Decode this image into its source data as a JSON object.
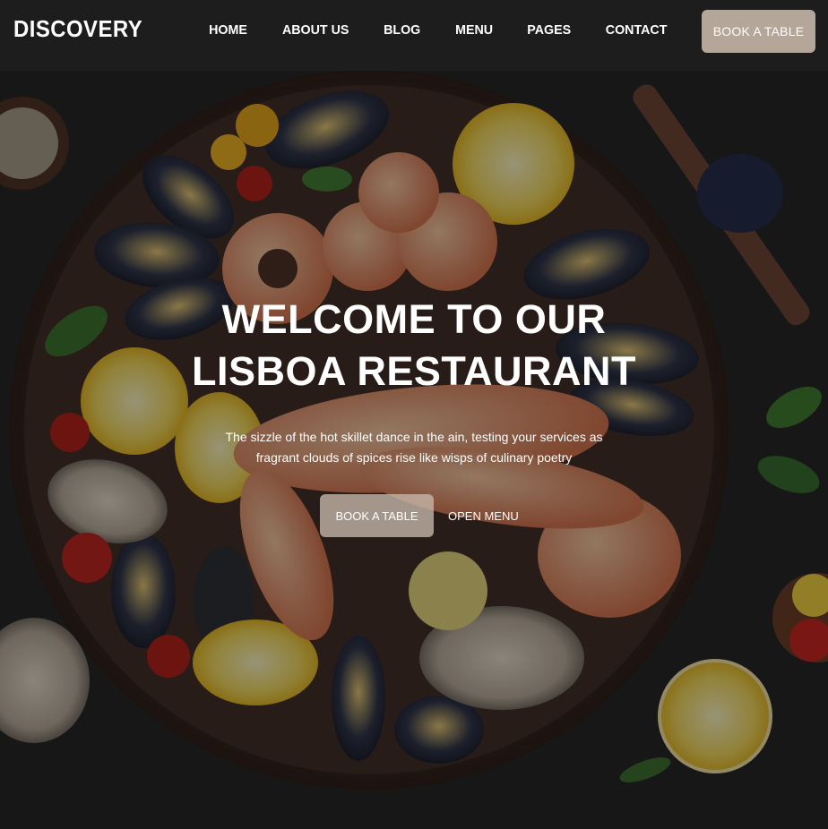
{
  "brand": {
    "logo": "DISCOVERY"
  },
  "nav": {
    "items": [
      "HOME",
      "ABOUT US",
      "BLOG",
      "MENU",
      "PAGES",
      "CONTACT"
    ],
    "cta_label": "BOOK A TABLE"
  },
  "hero": {
    "title_line1": "WELCOME TO OUR",
    "title_line2": "LISBOA RESTAURANT",
    "subtitle_line1": "The sizzle of the hot skillet dance in the ain, testing your services as",
    "subtitle_line2": "fragrant clouds of spices rise like wisps of culinary poetry",
    "primary_button": "BOOK A TABLE",
    "secondary_button": "OPEN MENU"
  },
  "colors": {
    "header_bg": "#1e1e1f",
    "cta_bg": "#b5a69a",
    "text": "#ffffff"
  }
}
